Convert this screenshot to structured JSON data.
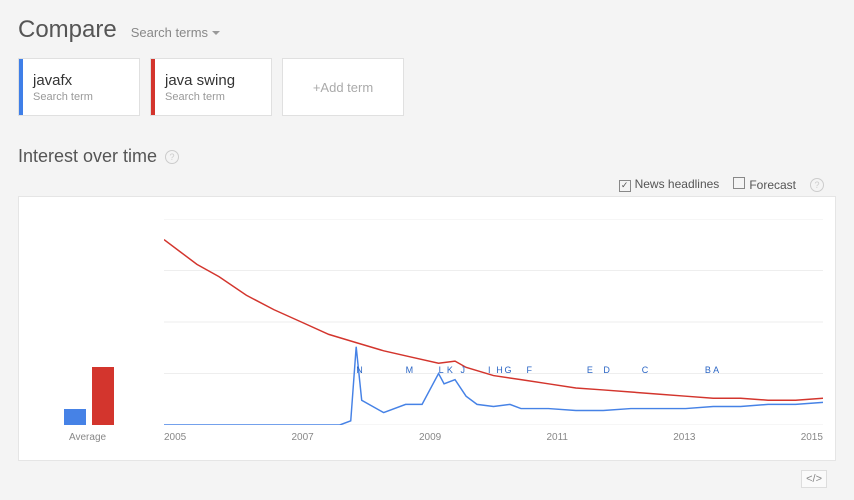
{
  "header": {
    "compare_label": "Compare",
    "search_terms_label": "Search terms"
  },
  "terms": [
    {
      "name": "javafx",
      "sub": "Search term",
      "color": "#3f7fe8"
    },
    {
      "name": "java swing",
      "sub": "Search term",
      "color": "#d3352d"
    }
  ],
  "add_term_label": "+Add term",
  "section": {
    "title": "Interest over time"
  },
  "options": {
    "news_headlines": {
      "label": "News headlines",
      "checked": true
    },
    "forecast": {
      "label": "Forecast",
      "checked": false
    }
  },
  "chart_data": {
    "type": "line",
    "title": "Interest over time",
    "xlabel": "",
    "ylabel": "",
    "ylim": [
      0,
      100
    ],
    "x_axis_ticks": [
      "2005",
      "2007",
      "2009",
      "2011",
      "2013",
      "2015"
    ],
    "x_range": [
      2004,
      2016
    ],
    "average_label": "Average",
    "average_bars": [
      {
        "series": "javafx",
        "value": 7,
        "color": "#4682e6"
      },
      {
        "series": "java swing",
        "value": 27,
        "color": "#d3352d"
      }
    ],
    "series": [
      {
        "name": "javafx",
        "color": "#4682e6",
        "x": [
          2004.0,
          2005.0,
          2006.0,
          2007.2,
          2007.4,
          2007.5,
          2007.6,
          2008.0,
          2008.4,
          2008.7,
          2009.0,
          2009.1,
          2009.3,
          2009.5,
          2009.7,
          2010.0,
          2010.3,
          2010.5,
          2011.0,
          2011.5,
          2012.0,
          2012.5,
          2013.0,
          2013.5,
          2014.0,
          2014.5,
          2015.0,
          2015.5,
          2016.0
        ],
        "values": [
          0,
          0,
          0,
          0,
          2,
          38,
          12,
          6,
          10,
          10,
          25,
          20,
          22,
          14,
          10,
          9,
          10,
          8,
          8,
          7,
          7,
          8,
          8,
          8,
          9,
          9,
          10,
          10,
          11
        ]
      },
      {
        "name": "java swing",
        "color": "#d3352d",
        "x": [
          2004.0,
          2004.3,
          2004.6,
          2005.0,
          2005.5,
          2006.0,
          2006.5,
          2007.0,
          2007.5,
          2008.0,
          2008.5,
          2009.0,
          2009.3,
          2009.5,
          2010.0,
          2010.5,
          2011.0,
          2011.5,
          2012.0,
          2012.5,
          2013.0,
          2013.5,
          2014.0,
          2014.5,
          2015.0,
          2015.5,
          2016.0
        ],
        "values": [
          90,
          84,
          78,
          72,
          63,
          56,
          50,
          44,
          40,
          36,
          33,
          30,
          31,
          28,
          24,
          22,
          20,
          18,
          17,
          16,
          15,
          14,
          13,
          13,
          12,
          12,
          13
        ]
      }
    ],
    "markers": [
      {
        "label": "N",
        "x": 2007.5
      },
      {
        "label": "M",
        "x": 2008.4
      },
      {
        "label": "L",
        "x": 2009.0
      },
      {
        "label": "K",
        "x": 2009.15
      },
      {
        "label": "J",
        "x": 2009.4
      },
      {
        "label": "I",
        "x": 2009.9
      },
      {
        "label": "H",
        "x": 2010.05
      },
      {
        "label": "G",
        "x": 2010.2
      },
      {
        "label": "F",
        "x": 2010.6
      },
      {
        "label": "E",
        "x": 2011.7
      },
      {
        "label": "D",
        "x": 2012.0
      },
      {
        "label": "C",
        "x": 2012.7
      },
      {
        "label": "B",
        "x": 2013.85
      },
      {
        "label": "A",
        "x": 2014.0
      }
    ]
  },
  "embed_label": "</>"
}
